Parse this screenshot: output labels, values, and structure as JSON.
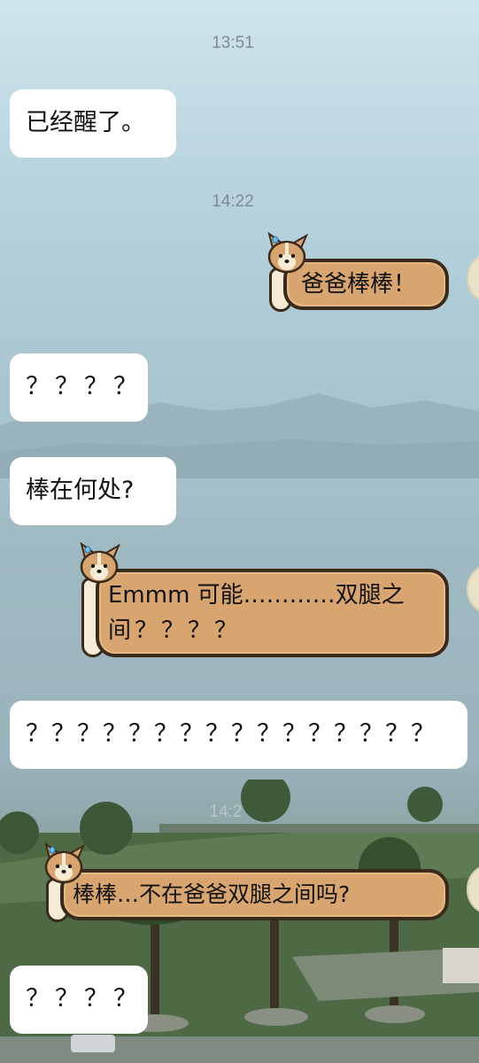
{
  "timestamps": [
    "13:51",
    "14:22",
    "14:2"
  ],
  "messages": [
    {
      "side": "left",
      "text": "已经醒了。"
    },
    {
      "side": "right",
      "text": "爸爸棒棒！"
    },
    {
      "side": "left",
      "text": "？？？？"
    },
    {
      "side": "left",
      "text": "棒在何处?"
    },
    {
      "side": "right",
      "line1": "Emmm 可能…………双腿之",
      "line2": "间？？？？"
    },
    {
      "side": "left",
      "text": "？？？？？？？？？？？？？？？？"
    },
    {
      "side": "right",
      "text": "棒棒…不在爸爸双腿之间吗?"
    },
    {
      "side": "left",
      "text": "？？？？"
    }
  ],
  "colors": {
    "bubble_left": "#ffffff",
    "sticker_bubble": "#d8a46f",
    "sticker_outline": "#3a2a1c"
  },
  "icons": [
    "corgi-sticker-icon",
    "sweat-drop-icon",
    "avatar"
  ]
}
